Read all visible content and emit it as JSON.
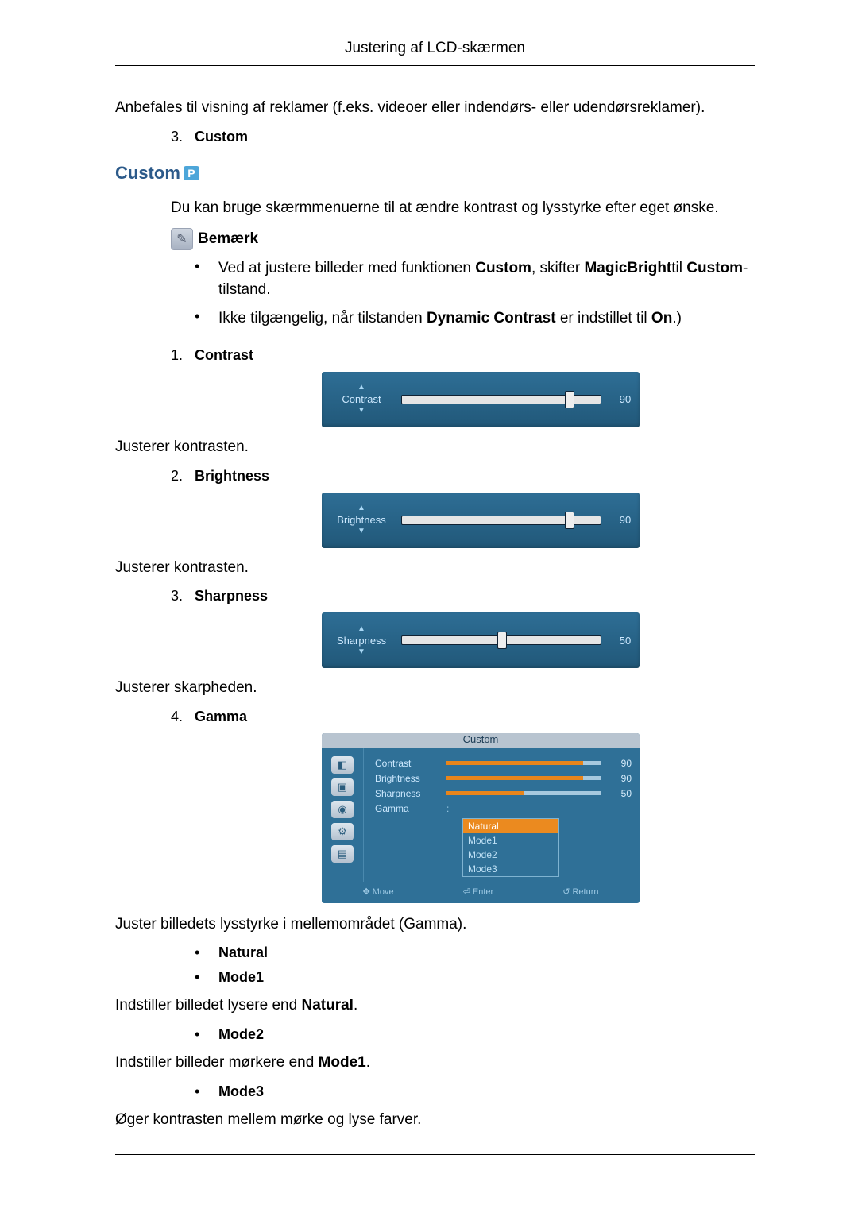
{
  "header": {
    "title": "Justering af LCD-skærmen"
  },
  "intro_para": "Anbefales til visning af reklamer (f.eks. videoer eller indendørs- eller udendørsreklamer).",
  "item3": {
    "num": "3.",
    "label": "Custom"
  },
  "section": {
    "heading": "Custom",
    "p_icon": "P",
    "description": "Du kan bruge skærmmenuerne til at ændre kontrast og lysstyrke efter eget ønske.",
    "note_label": "Bemærk",
    "notes": [
      {
        "pre": "Ved at justere billeder med funktionen ",
        "b1": "Custom",
        "mid1": ", skifter ",
        "b2": "MagicBright",
        "mid2": "til ",
        "b3": "Custom",
        "post": "-tilstand."
      },
      {
        "pre": "Ikke tilgængelig, når tilstanden ",
        "b1": "Dynamic Contrast",
        "mid1": " er indstillet til ",
        "b2": "On",
        "post": ".)"
      }
    ],
    "items": [
      {
        "num": "1.",
        "label": "Contrast",
        "osd_label": "Contrast",
        "value": 90,
        "handle_pct": 82,
        "desc": "Justerer kontrasten."
      },
      {
        "num": "2.",
        "label": "Brightness",
        "osd_label": "Brightness",
        "value": 90,
        "handle_pct": 82,
        "desc": "Justerer kontrasten."
      },
      {
        "num": "3.",
        "label": "Sharpness",
        "osd_label": "Sharpness",
        "value": 50,
        "handle_pct": 48,
        "desc": "Justerer skarpheden."
      },
      {
        "num": "4.",
        "label": "Gamma"
      }
    ],
    "gamma_panel": {
      "title": "Custom",
      "rows": [
        {
          "name": "Contrast",
          "value": 90,
          "fill_pct": 88
        },
        {
          "name": "Brightness",
          "value": 90,
          "fill_pct": 88
        },
        {
          "name": "Sharpness",
          "value": 50,
          "fill_pct": 50
        }
      ],
      "gamma_label": "Gamma",
      "options": [
        "Natural",
        "Mode1",
        "Mode2",
        "Mode3"
      ],
      "selected": "Natural",
      "footer": {
        "move": "Move",
        "enter": "Enter",
        "return": "Return"
      }
    },
    "gamma_desc": "Juster billedets lysstyrke i mellemområdet (Gamma).",
    "gamma_modes": {
      "natural": "Natural",
      "mode1": "Mode1",
      "mode1_desc_pre": "Indstiller billedet lysere end ",
      "mode1_desc_bold": "Natural",
      "mode1_desc_post": ".",
      "mode2": "Mode2",
      "mode2_desc_pre": "Indstiller billeder mørkere end ",
      "mode2_desc_bold": "Mode1",
      "mode2_desc_post": ".",
      "mode3": "Mode3",
      "mode3_desc": "Øger kontrasten mellem mørke og lyse farver."
    }
  }
}
